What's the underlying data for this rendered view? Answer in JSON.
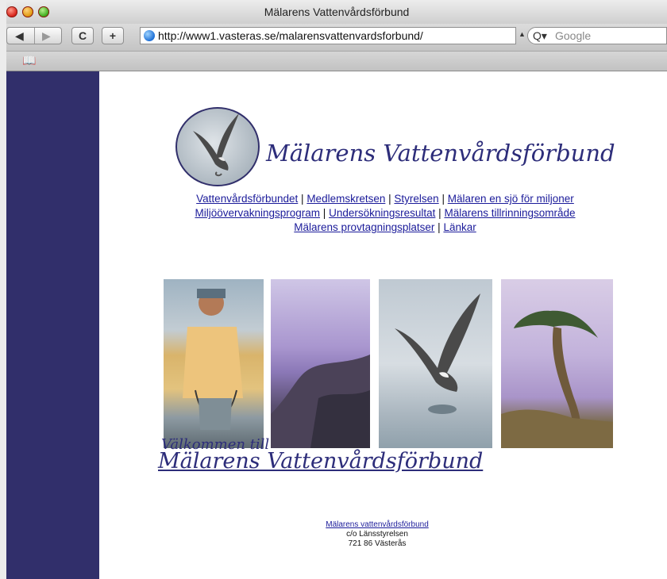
{
  "browser": {
    "title": "Mälarens Vattenvårdsförbund",
    "url": "http://www1.vasteras.se/malarensvattenvardsforbund/",
    "search_placeholder": "Google",
    "back_icon": "back-arrow-icon",
    "forward_icon": "forward-arrow-icon",
    "reload_icon": "reload-icon",
    "add_icon": "plus-icon",
    "bookmarks_icon": "book-icon"
  },
  "page": {
    "logo_text": "Mälarens Vattenvårdsförbund",
    "nav": {
      "row1": [
        "Vattenvårdsförbundet",
        "Medlemskretsen",
        "Styrelsen",
        "Mälaren en sjö för miljoner"
      ],
      "row2": [
        "Miljöövervakningsprogram",
        "Undersökningsresultat",
        "Mälarens tillrinningsområde"
      ],
      "row3": [
        "Mälarens provtagningsplatser",
        "Länkar"
      ],
      "separator": "|"
    },
    "welcome_line1": "Välkommen till",
    "welcome_line2": "Mälarens Vattenvårdsförbund",
    "footer": {
      "link": "Mälarens vattenvårdsförbund",
      "line2": "c/o Länsstyrelsen",
      "line3": "721 86 Västerås"
    },
    "colors": {
      "sidebar": "#312f6b",
      "link": "#1b1b9a",
      "accent": "#2d2d7a"
    }
  }
}
